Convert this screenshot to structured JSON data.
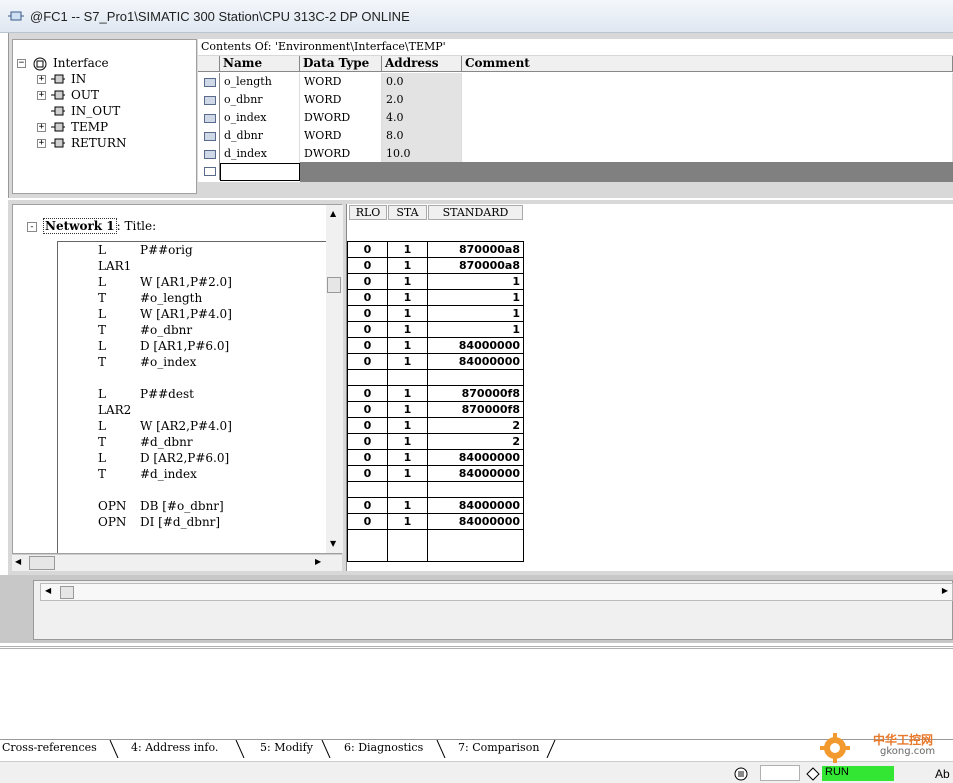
{
  "window": {
    "title": "@FC1 -- S7_Pro1\\SIMATIC 300 Station\\CPU 313C-2 DP  ONLINE"
  },
  "tree": {
    "root": "Interface",
    "items": [
      {
        "label": "IN",
        "expander": "+"
      },
      {
        "label": "OUT",
        "expander": "+"
      },
      {
        "label": "IN_OUT",
        "expander": ""
      },
      {
        "label": "TEMP",
        "expander": "+"
      },
      {
        "label": "RETURN",
        "expander": "+"
      }
    ]
  },
  "contents_of": "Contents Of: 'Environment\\Interface\\TEMP'",
  "decl": {
    "headers": [
      "Name",
      "Data Type",
      "Address",
      "Comment"
    ],
    "rows": [
      {
        "name": "o_length",
        "type": "WORD",
        "address": "0.0"
      },
      {
        "name": "o_dbnr",
        "type": "WORD",
        "address": "2.0"
      },
      {
        "name": "o_index",
        "type": "DWORD",
        "address": "4.0"
      },
      {
        "name": "d_dbnr",
        "type": "WORD",
        "address": "8.0"
      },
      {
        "name": "d_index",
        "type": "DWORD",
        "address": "10.0"
      }
    ],
    "new_row_value": ""
  },
  "network": {
    "expander": "-",
    "label": "Network 1",
    "title_suffix": ": Title:"
  },
  "code": [
    {
      "op": "L",
      "arg": "P##orig"
    },
    {
      "op": "LAR1",
      "arg": ""
    },
    {
      "op": "L",
      "arg": "W [AR1,P#2.0]"
    },
    {
      "op": "T",
      "arg": "#o_length"
    },
    {
      "op": "L",
      "arg": "W [AR1,P#4.0]"
    },
    {
      "op": "T",
      "arg": "#o_dbnr"
    },
    {
      "op": "L",
      "arg": "D [AR1,P#6.0]"
    },
    {
      "op": "T",
      "arg": "#o_index"
    },
    {
      "op": "",
      "arg": ""
    },
    {
      "op": "L",
      "arg": "P##dest"
    },
    {
      "op": "LAR2",
      "arg": ""
    },
    {
      "op": "L",
      "arg": "W [AR2,P#4.0]"
    },
    {
      "op": "T",
      "arg": "#d_dbnr"
    },
    {
      "op": "L",
      "arg": "D [AR2,P#6.0]"
    },
    {
      "op": "T",
      "arg": "#d_index"
    },
    {
      "op": "",
      "arg": ""
    },
    {
      "op": "OPN",
      "arg": "DB [#o_dbnr]"
    },
    {
      "op": "OPN",
      "arg": "DI [#d_dbnr]"
    }
  ],
  "status": {
    "headers": [
      "RLO",
      "STA",
      "STANDARD"
    ],
    "rows": [
      [
        "0",
        "1",
        "870000a8"
      ],
      [
        "0",
        "1",
        "870000a8"
      ],
      [
        "0",
        "1",
        "1"
      ],
      [
        "0",
        "1",
        "1"
      ],
      [
        "0",
        "1",
        "1"
      ],
      [
        "0",
        "1",
        "1"
      ],
      [
        "0",
        "1",
        "84000000"
      ],
      [
        "0",
        "1",
        "84000000"
      ],
      [
        "",
        "",
        ""
      ],
      [
        "0",
        "1",
        "870000f8"
      ],
      [
        "0",
        "1",
        "870000f8"
      ],
      [
        "0",
        "1",
        "2"
      ],
      [
        "0",
        "1",
        "2"
      ],
      [
        "0",
        "1",
        "84000000"
      ],
      [
        "0",
        "1",
        "84000000"
      ],
      [
        "",
        "",
        ""
      ],
      [
        "0",
        "1",
        "84000000"
      ],
      [
        "0",
        "1",
        "84000000"
      ]
    ]
  },
  "tabs": [
    "Cross-references",
    "4: Address info.",
    "5: Modify",
    "6: Diagnostics",
    "7: Comparison"
  ],
  "statusbar": {
    "mode": "RUN",
    "abbr": "Ab"
  },
  "watermark": {
    "cn": "中华工控网",
    "url": "gkong.com"
  },
  "colors": {
    "run": "#33e633",
    "pane_bg": "#d8d8d8",
    "header_bg": "#f0f0f0"
  }
}
